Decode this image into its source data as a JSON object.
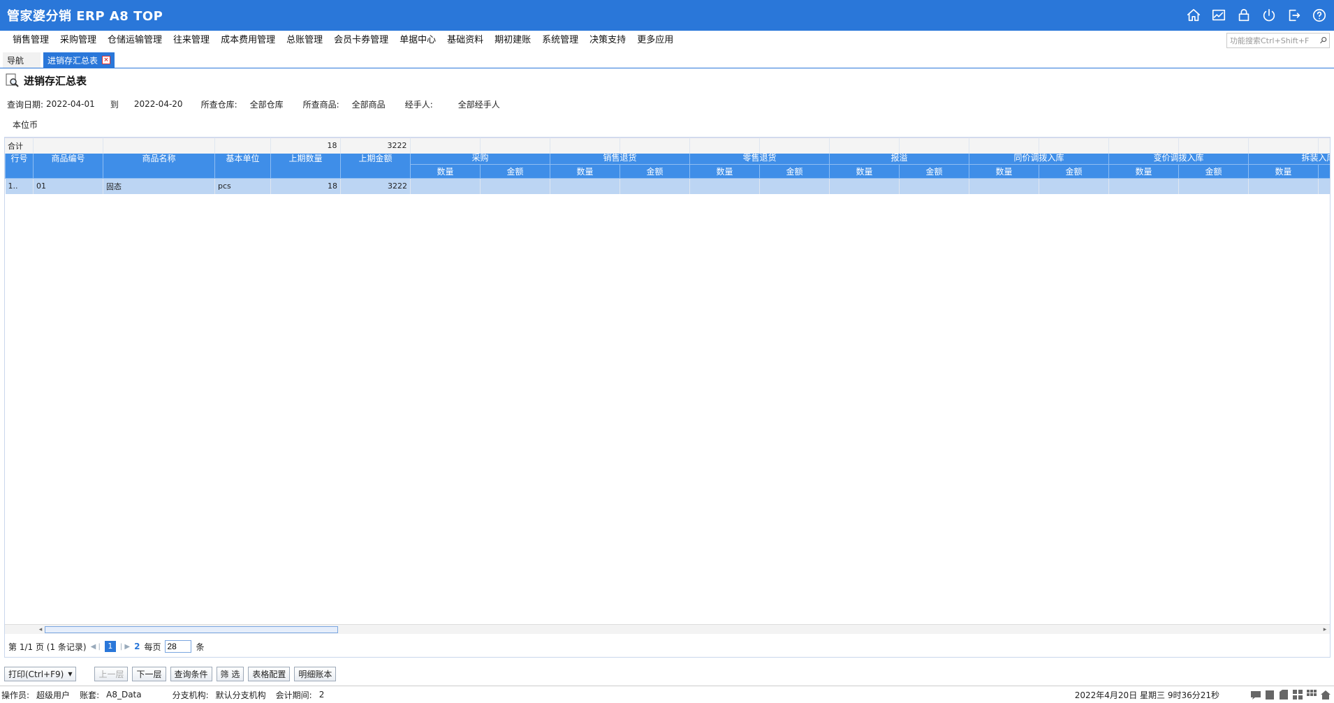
{
  "app": {
    "title": "管家婆分销 ERP A8 TOP"
  },
  "menu": [
    "销售管理",
    "采购管理",
    "仓储运输管理",
    "往来管理",
    "成本费用管理",
    "总账管理",
    "会员卡券管理",
    "单据中心",
    "基础资料",
    "期初建账",
    "系统管理",
    "决策支持",
    "更多应用"
  ],
  "search": {
    "placeholder": "功能搜索Ctrl+Shift+F"
  },
  "tabs": {
    "nav": "导航",
    "active": "进销存汇总表"
  },
  "page": {
    "title": "进销存汇总表"
  },
  "query": {
    "date_label": "查询日期:",
    "date_from": "2022-04-01",
    "to_label": "到",
    "date_to": "2022-04-20",
    "warehouse_label": "所查仓库:",
    "warehouse": "全部仓库",
    "goods_label": "所查商品:",
    "goods": "全部商品",
    "handler_label": "经手人:",
    "handler": "全部经手人"
  },
  "currency": "本位币",
  "table": {
    "fixed_headers": [
      "行号",
      "商品编号",
      "商品名称",
      "基本单位",
      "上期数量",
      "上期金额"
    ],
    "groups": [
      "采购",
      "销售退货",
      "零售退货",
      "报溢",
      "同价调拨入库",
      "变价调拨入库",
      "拆装入库"
    ],
    "sub_qty": "数量",
    "sub_amt": "金额",
    "rows": [
      {
        "row": "1..",
        "code": "01",
        "name": "固态",
        "unit": "pcs",
        "qty": "18",
        "amount": "3222"
      }
    ],
    "total": {
      "label": "合计",
      "qty": "18",
      "amount": "3222"
    }
  },
  "pager": {
    "page_info": "第  1/1 页  (1 条记录)",
    "current": "1",
    "refresh": "2",
    "per_page_label": "每页",
    "per_page": "28",
    "unit": "条"
  },
  "buttons": {
    "print": "打印(Ctrl+F9)",
    "up": "上一层",
    "down": "下一层",
    "query": "查询条件",
    "filter": "筛  选",
    "config": "表格配置",
    "detail": "明细账本"
  },
  "status": {
    "operator_label": "操作员:",
    "operator": "超级用户",
    "account_label": "账套:",
    "account": "A8_Data",
    "branch_label": "分支机构:",
    "branch": "默认分支机构",
    "period_label": "会计期间:",
    "period": "2",
    "datetime": "2022年4月20日  星期三  9时36分21秒"
  },
  "icons": [
    "home-icon",
    "chart-icon",
    "lock-icon",
    "power-icon",
    "exit-icon",
    "help-icon"
  ]
}
